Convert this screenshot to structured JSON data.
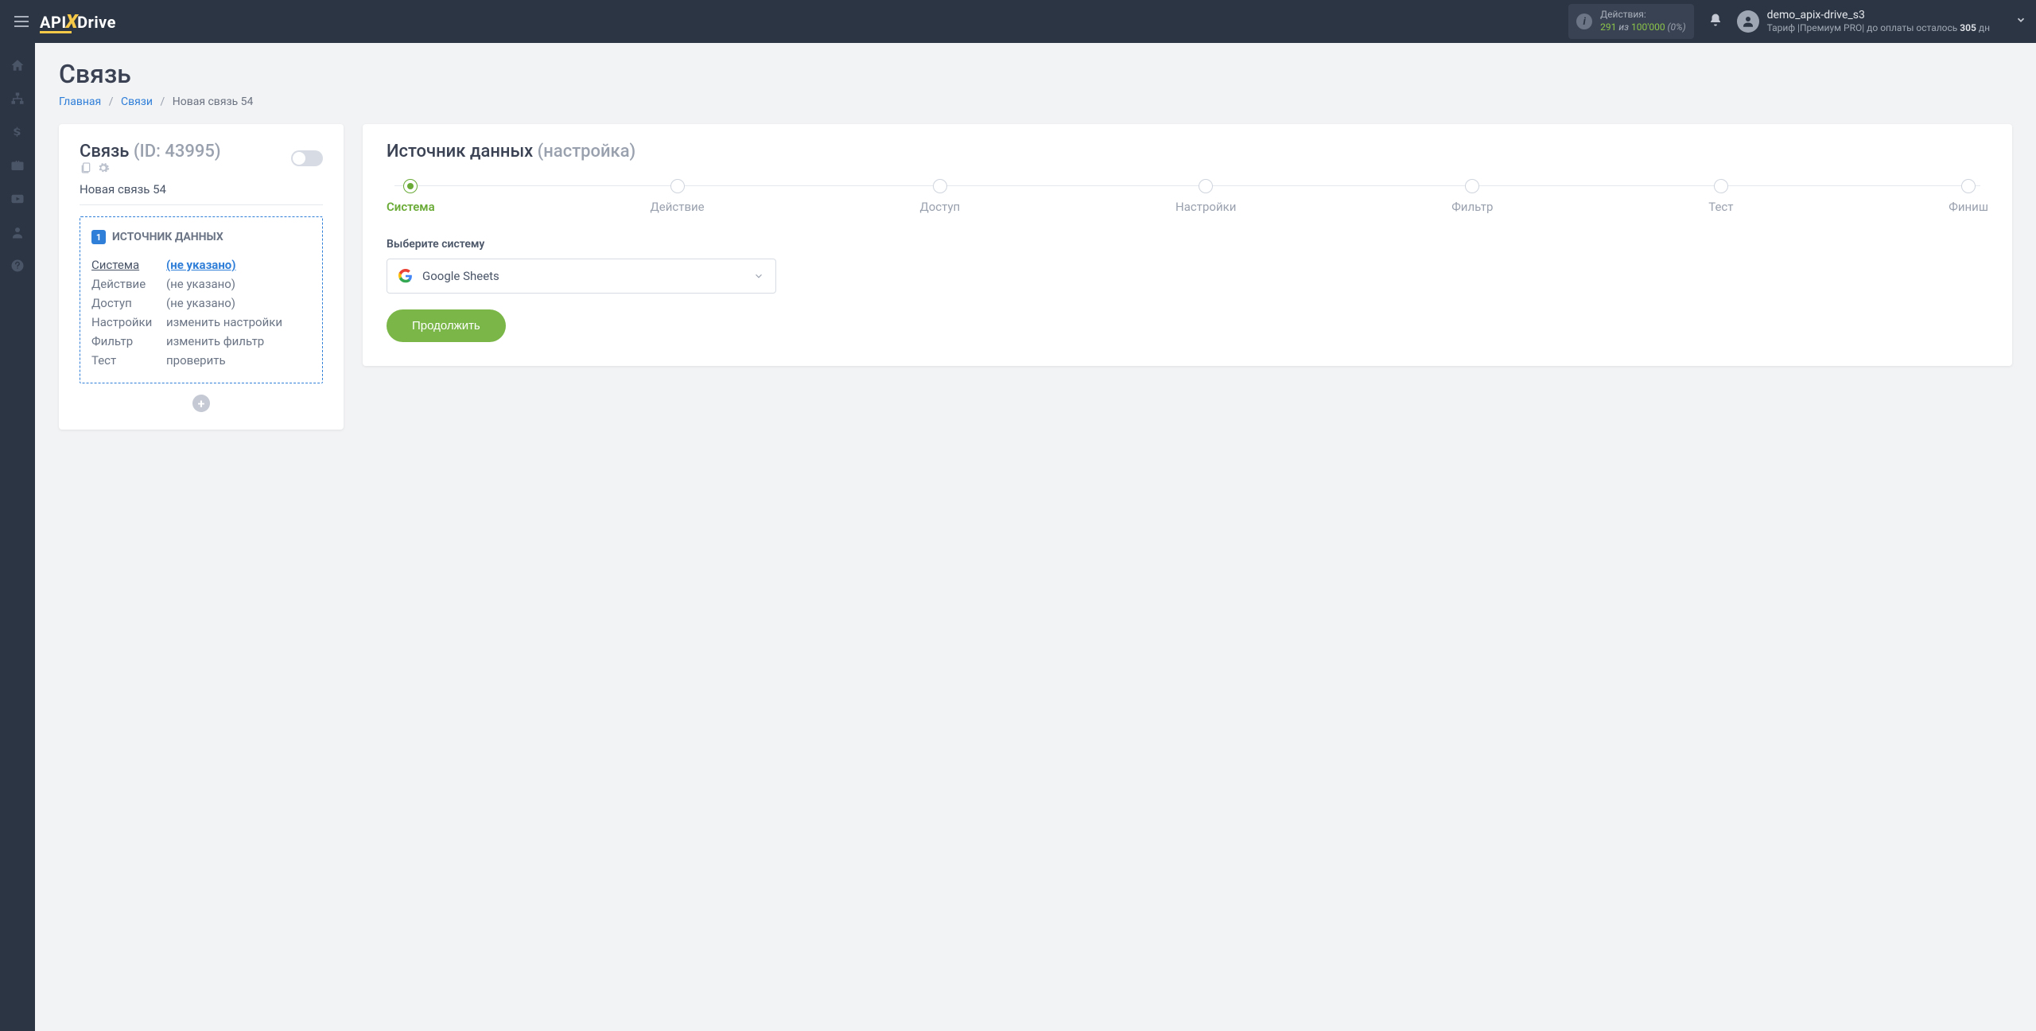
{
  "header": {
    "logo": {
      "part1": "API",
      "part2": "X",
      "part3": "Drive"
    },
    "actions": {
      "label": "Действия:",
      "current": "291",
      "of": "из",
      "total": "100'000",
      "pct": "(0%)"
    },
    "user": {
      "name": "demo_apix-drive_s3",
      "plan_prefix": "Тариф |Премиум PRO| до оплаты осталось ",
      "days": "305",
      "days_suffix": " дн"
    }
  },
  "page": {
    "title": "Связь",
    "breadcrumbs": {
      "home": "Главная",
      "connections": "Связи",
      "current": "Новая связь 54"
    }
  },
  "left": {
    "title": "Связь",
    "id_label": "(ID: 43995)",
    "conn_name": "Новая связь 54",
    "box_title": "ИСТОЧНИК ДАННЫХ",
    "rows": [
      {
        "key": "Система",
        "val": "(не указано)",
        "active": true
      },
      {
        "key": "Действие",
        "val": "(не указано)"
      },
      {
        "key": "Доступ",
        "val": "(не указано)"
      },
      {
        "key": "Настройки",
        "val": "изменить настройки"
      },
      {
        "key": "Фильтр",
        "val": "изменить фильтр"
      },
      {
        "key": "Тест",
        "val": "проверить"
      }
    ]
  },
  "right": {
    "title": "Источник данных",
    "subtitle": "(настройка)",
    "steps": [
      "Система",
      "Действие",
      "Доступ",
      "Настройки",
      "Фильтр",
      "Тест",
      "Финиш"
    ],
    "active_step": 0,
    "select_label": "Выберите систему",
    "select_value": "Google Sheets",
    "continue": "Продолжить"
  }
}
